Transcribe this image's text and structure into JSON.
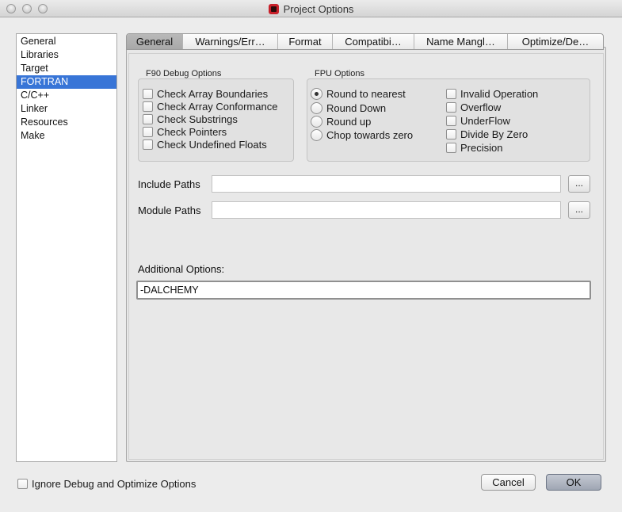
{
  "window": {
    "title": "Project Options"
  },
  "categories": [
    "General",
    "Libraries",
    "Target",
    "FORTRAN",
    "C/C++",
    "Linker",
    "Resources",
    "Make"
  ],
  "selected_category": "FORTRAN",
  "tabs": [
    "General",
    "Warnings/Err…",
    "Format",
    "Compatibi…",
    "Name Mangl…",
    "Optimize/De…"
  ],
  "active_tab": "General",
  "f90_debug": {
    "title": "F90 Debug Options",
    "options": [
      {
        "label": "Check Array Boundaries",
        "checked": false
      },
      {
        "label": "Check Array Conformance",
        "checked": false
      },
      {
        "label": "Check Substrings",
        "checked": false
      },
      {
        "label": "Check Pointers",
        "checked": false
      },
      {
        "label": "Check Undefined Floats",
        "checked": false
      }
    ]
  },
  "fpu": {
    "title": "FPU Options",
    "rounding": [
      {
        "label": "Round to nearest",
        "selected": true
      },
      {
        "label": "Round Down",
        "selected": false
      },
      {
        "label": "Round up",
        "selected": false
      },
      {
        "label": "Chop towards zero",
        "selected": false
      }
    ],
    "exceptions": [
      {
        "label": "Invalid Operation",
        "checked": false
      },
      {
        "label": "Overflow",
        "checked": false
      },
      {
        "label": "UnderFlow",
        "checked": false
      },
      {
        "label": "Divide By Zero",
        "checked": false
      },
      {
        "label": "Precision",
        "checked": false
      }
    ]
  },
  "include_paths": {
    "label": "Include Paths",
    "value": "",
    "browse": "..."
  },
  "module_paths": {
    "label": "Module Paths",
    "value": "",
    "browse": "..."
  },
  "additional_options": {
    "label": "Additional Options:",
    "value": "-DALCHEMY"
  },
  "ignore_debug": {
    "label": "Ignore Debug and Optimize Options",
    "checked": false
  },
  "buttons": {
    "cancel": "Cancel",
    "ok": "OK"
  }
}
